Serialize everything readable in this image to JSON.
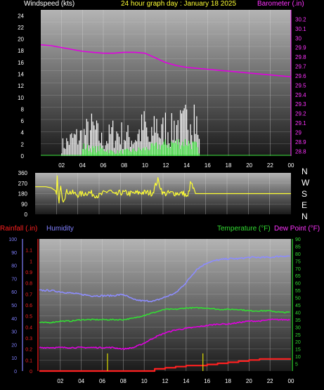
{
  "title": "24 hour graph day : January 18 2025",
  "colors": {
    "white": "#ffffff",
    "yellow": "#ffff33",
    "magenta": "#e000e0",
    "barometer_axis": "#ff33ff",
    "blue_label": "#8080ff",
    "humidity": "#8c8cff",
    "green": "#33dd33",
    "red": "#ff2020",
    "plot_light": "#b4b4b4",
    "plot_dark": "#1a1a1a"
  },
  "chart_data": [
    {
      "type": "line",
      "ylabel": "Windspeed (kts)",
      "y2label": "Barometer (.in)",
      "x_ticks": [
        "02",
        "04",
        "06",
        "08",
        "10",
        "12",
        "14",
        "16",
        "18",
        "20",
        "22",
        "00"
      ],
      "ylim": [
        0,
        25
      ],
      "y_ticks": [
        "0",
        "2",
        "4",
        "6",
        "8",
        "10",
        "12",
        "14",
        "16",
        "18",
        "20",
        "22",
        "24"
      ],
      "y2lim": [
        28.75,
        30.3
      ],
      "y2_ticks": [
        "28.8",
        "28.9",
        "29",
        "29.1",
        "29.2",
        "29.3",
        "29.4",
        "29.5",
        "29.6",
        "29.7",
        "29.8",
        "29.9",
        "30",
        "30.1",
        "30.2"
      ],
      "series": [
        {
          "name": "Barometer",
          "axis": "right",
          "x": [
            0,
            1,
            2,
            3,
            4,
            5,
            6,
            7,
            8,
            9,
            10,
            11,
            12,
            13,
            14,
            15,
            16,
            17,
            18,
            19,
            20,
            21,
            22,
            23,
            24
          ],
          "values": [
            29.93,
            29.92,
            29.9,
            29.88,
            29.86,
            29.85,
            29.84,
            29.84,
            29.85,
            29.85,
            29.84,
            29.79,
            29.74,
            29.71,
            29.69,
            29.68,
            29.67,
            29.66,
            29.65,
            29.64,
            29.63,
            29.62,
            29.61,
            29.6,
            29.59
          ]
        },
        {
          "name": "Wind gust",
          "x": [
            2,
            3,
            4,
            5,
            6,
            7,
            8,
            9,
            10,
            10.5,
            11,
            11.5,
            12,
            12.5,
            13,
            13.5,
            14,
            14.5,
            15,
            15.2
          ],
          "values": [
            3,
            5,
            6,
            8,
            4,
            7,
            6,
            5,
            9,
            3,
            11,
            6,
            9,
            7,
            10,
            8,
            10,
            17,
            8,
            4
          ]
        },
        {
          "name": "Wind average",
          "x": [
            0,
            1,
            2,
            3,
            4,
            5,
            6,
            7,
            8,
            9,
            10,
            11,
            12,
            13,
            14,
            15,
            15.2
          ],
          "values": [
            0,
            0.3,
            0.6,
            1,
            2,
            1.5,
            1.5,
            0.8,
            1,
            1.2,
            1.5,
            2,
            2.5,
            2.8,
            3,
            2,
            0
          ]
        }
      ]
    },
    {
      "type": "line",
      "ylabel": "Wind direction",
      "x_ticks": [
        "02",
        "04",
        "06",
        "08",
        "10",
        "12",
        "14",
        "16",
        "18",
        "20",
        "22",
        "00"
      ],
      "ylim": [
        0,
        360
      ],
      "y_ticks": [
        "0",
        "90",
        "180",
        "270",
        "360"
      ],
      "compass": [
        "N",
        "W",
        "S",
        "E",
        "N"
      ],
      "series": [
        {
          "name": "Direction",
          "x": [
            0,
            1,
            1.5,
            2,
            2.1,
            2.2,
            2.4,
            2.6,
            3,
            4,
            5,
            6,
            7,
            7.5,
            8,
            9,
            10,
            11,
            11.5,
            12,
            13,
            14,
            14.3,
            14.6,
            15,
            24
          ],
          "values": [
            240,
            240,
            230,
            200,
            350,
            40,
            270,
            120,
            200,
            170,
            190,
            160,
            210,
            160,
            190,
            180,
            190,
            185,
            300,
            180,
            185,
            180,
            140,
            280,
            180,
            180
          ]
        }
      ]
    },
    {
      "type": "line",
      "ylabel": "Rainfall (.in)",
      "y2label": "Humidity",
      "y3label": "Temperature (°F)",
      "y4label": "Dew Point (°F)",
      "x_ticks": [
        "02",
        "04",
        "06",
        "08",
        "10",
        "12",
        "14",
        "16",
        "18",
        "20",
        "22",
        "00"
      ],
      "rain_lim": [
        0,
        1.2
      ],
      "rain_ticks": [
        "0",
        "0.1",
        "0.2",
        "0.3",
        "0.4",
        "0.5",
        "0.6",
        "0.7",
        "0.8",
        "0.9",
        "1",
        "1.1"
      ],
      "hum_lim": [
        0,
        100
      ],
      "hum_ticks": [
        "0",
        "10",
        "20",
        "30",
        "40",
        "50",
        "60",
        "70",
        "80",
        "90",
        "100"
      ],
      "temp_lim": [
        0,
        90
      ],
      "temp_ticks": [
        "5",
        "10",
        "15",
        "20",
        "25",
        "30",
        "35",
        "40",
        "45",
        "50",
        "55",
        "60",
        "65",
        "70",
        "75",
        "80",
        "85",
        "90"
      ],
      "series": [
        {
          "name": "Humidity",
          "axis": "humidity",
          "x": [
            0,
            1,
            2,
            3,
            4,
            5,
            6,
            7,
            8,
            9,
            10,
            11,
            12,
            13,
            14,
            15,
            16,
            17,
            18,
            19,
            20,
            21,
            22,
            23,
            24
          ],
          "values": [
            61,
            61,
            60,
            59,
            58,
            57,
            57,
            57,
            58,
            54,
            53,
            53,
            56,
            59,
            67,
            77,
            82,
            84,
            85,
            85,
            86,
            86,
            86,
            87,
            87
          ]
        },
        {
          "name": "Temperature",
          "axis": "temp",
          "x": [
            0,
            1,
            2,
            3,
            4,
            5,
            6,
            7,
            8,
            9,
            10,
            11,
            12,
            13,
            14,
            15,
            16,
            17,
            18,
            19,
            20,
            21,
            22,
            23,
            24
          ],
          "values": [
            33,
            33,
            34,
            34,
            35,
            35,
            35,
            35,
            35,
            36,
            38,
            40,
            42,
            42,
            43,
            43,
            43,
            42,
            42,
            42,
            41,
            41,
            41,
            40,
            40
          ]
        },
        {
          "name": "Dew Point",
          "axis": "temp",
          "x": [
            0,
            1,
            2,
            3,
            4,
            5,
            6,
            7,
            8,
            9,
            10,
            11,
            12,
            13,
            14,
            15,
            16,
            17,
            18,
            19,
            20,
            21,
            22,
            23,
            24
          ],
          "values": [
            16,
            16,
            16,
            16,
            16,
            16,
            16,
            16,
            15,
            16,
            19,
            23,
            26,
            28,
            29,
            30,
            31,
            32,
            32,
            33,
            34,
            34,
            35,
            35,
            35
          ]
        },
        {
          "name": "Rainfall",
          "axis": "rain",
          "x": [
            0,
            10,
            11,
            12,
            13,
            14,
            15,
            16,
            17,
            18,
            19,
            20,
            21,
            22,
            23,
            24
          ],
          "values": [
            0,
            0,
            0.02,
            0.03,
            0.04,
            0.05,
            0.05,
            0.06,
            0.07,
            0.08,
            0.09,
            0.1,
            0.11,
            0.11,
            0.11,
            0.11
          ]
        },
        {
          "name": "Rain rate",
          "axis": "rain",
          "x": [
            6.5,
            15.6
          ],
          "values": [
            0.16,
            0.16
          ]
        }
      ]
    }
  ]
}
